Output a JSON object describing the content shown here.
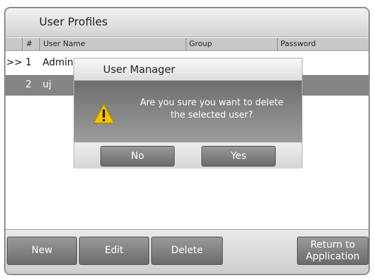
{
  "header": {
    "title": "User Profiles"
  },
  "table": {
    "columns": [
      "#",
      "User Name",
      "Group",
      "Password"
    ],
    "rows": [
      {
        "marker": ">>",
        "num": "1",
        "name": "Admin",
        "group": "",
        "password": ""
      },
      {
        "marker": "",
        "num": "2",
        "name": "uj",
        "group": "",
        "password": ""
      }
    ]
  },
  "dialog": {
    "title": "User Manager",
    "message_line1": "Are you sure you want to delete",
    "message_line2": "the selected user?",
    "no_label": "No",
    "yes_label": "Yes",
    "icon": "warning-icon"
  },
  "toolbar": {
    "new_label": "New",
    "edit_label": "Edit",
    "delete_label": "Delete",
    "return_line1": "Return to",
    "return_line2": "Application"
  },
  "colors": {
    "selected_row": "#858585",
    "button": "#7e7e7e",
    "warning": "#f5c400"
  }
}
